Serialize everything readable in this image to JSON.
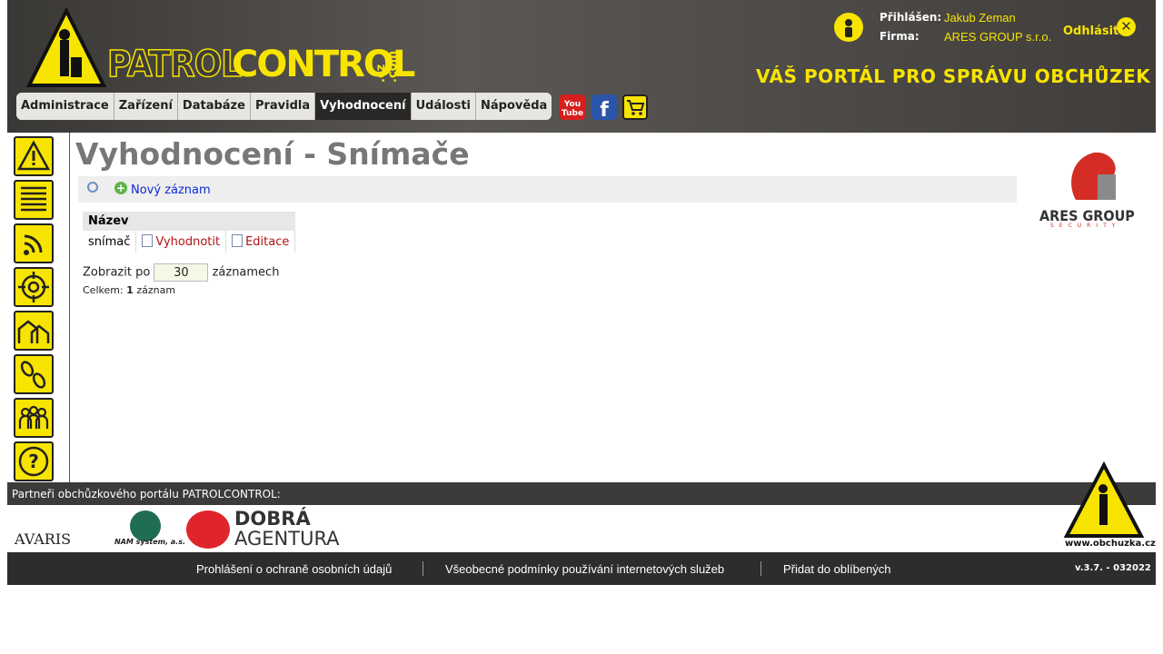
{
  "header": {
    "logo_left": "PATROL",
    "logo_right": "CONTROL",
    "logo_domain": ".cz .com",
    "logged_in_label": "Přihlášen:",
    "logged_in_user": "Jakub Zeman",
    "company_label": "Firma:",
    "company": "ARES GROUP s.r.o.",
    "logout": "Odhlásit",
    "slogan": "VÁŠ PORTÁL PRO SPRÁVU OBCHŮZEK"
  },
  "menu": {
    "items": [
      {
        "label": "Administrace"
      },
      {
        "label": "Zařízení"
      },
      {
        "label": "Databáze"
      },
      {
        "label": "Pravidla"
      },
      {
        "label": "Vyhodnocení"
      },
      {
        "label": "Události"
      },
      {
        "label": "Nápověda"
      }
    ],
    "active": "Vyhodnocení"
  },
  "main": {
    "title": "Vyhodnocení - Snímače",
    "new_record": "Nový záznam",
    "table": {
      "header": "Název",
      "rows": [
        {
          "name": "snímač",
          "evaluate": "Vyhodnotit",
          "edit": "Editace"
        }
      ]
    },
    "paging_prefix": "Zobrazit po",
    "per_page": "30",
    "paging_suffix": "záznamech",
    "total_label": "Celkem:",
    "total_count": "1",
    "total_unit": "záznam"
  },
  "sidebar_right": {
    "logo_text": "ARES GROUP",
    "logo_sub": "SECURITY"
  },
  "footer": {
    "partners_title": "Partneři obchůzkového portálu PATROLCONTROL:",
    "partner_1": "AVARIS",
    "partner_2": "NAM system, a.s.",
    "partner_3_top": "DOBRÁ",
    "partner_3_bottom": "AGENTURA",
    "obchuzka": "www.obchuzka.cz",
    "link_privacy": "Prohlášení o ochraně osobních údajů",
    "link_terms": "Všeobecné podmínky používání internetových služeb",
    "link_favorites": "Přidat do oblíbených",
    "version": "v.3.7. - 032022"
  },
  "colors": {
    "accent": "#f7e400",
    "header_bg": "#4a4745",
    "link": "#0a2ad8",
    "link_red": "#b01212"
  }
}
